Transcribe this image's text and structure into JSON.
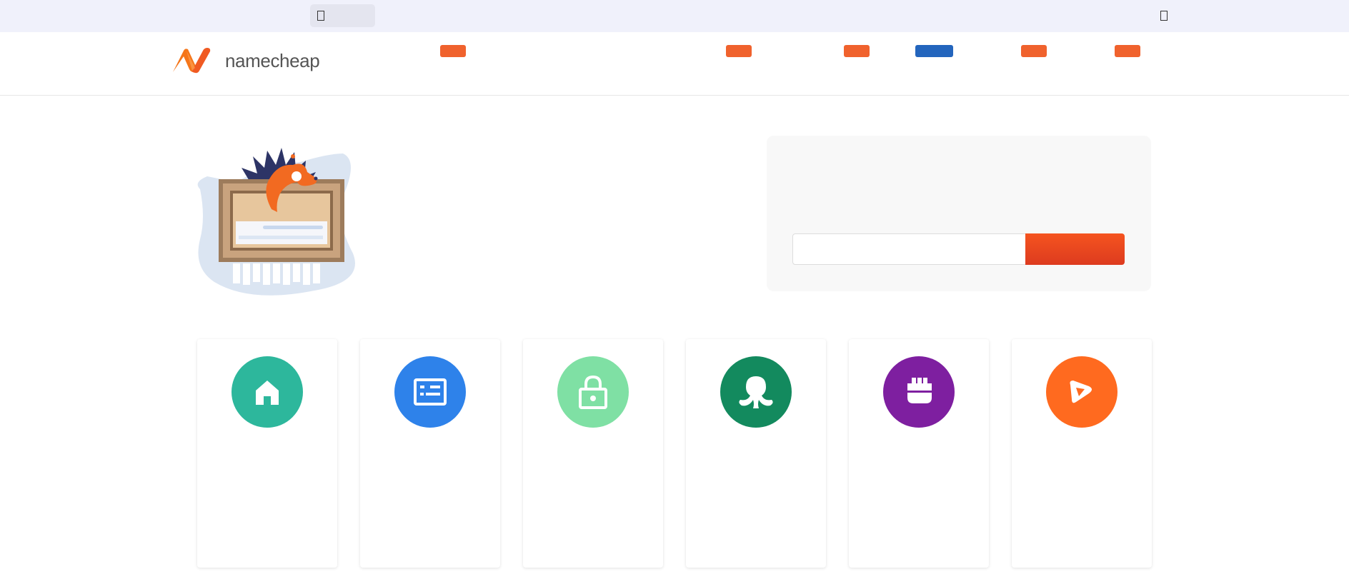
{
  "brand": {
    "name": "namecheap",
    "colors": {
      "orange": "#f0622d",
      "blue": "#2365bd"
    }
  },
  "topbar": {
    "icons": [
      "browser-tab-icon",
      "menu-icon"
    ]
  },
  "nav": {
    "items": [
      {
        "id": "nav-item-1",
        "color": "#f0622d"
      },
      {
        "id": "nav-item-2",
        "color": "#f0622d"
      },
      {
        "id": "nav-item-3",
        "color": "#f0622d"
      },
      {
        "id": "nav-item-4",
        "color": "#2365bd"
      },
      {
        "id": "nav-item-5",
        "color": "#f0622d"
      },
      {
        "id": "nav-item-6",
        "color": "#f0622d"
      }
    ]
  },
  "hero": {
    "illustration": "hedgehog-fox-frame-illustration"
  },
  "search": {
    "value": "",
    "placeholder": "",
    "button_label": ""
  },
  "product_cards": [
    {
      "icon": "house-icon",
      "color": "#2db79c"
    },
    {
      "icon": "server-icon",
      "color": "#2e82ea"
    },
    {
      "icon": "lock-icon",
      "color": "#7fe0a4"
    },
    {
      "icon": "octopus-icon",
      "color": "#138a5e"
    },
    {
      "icon": "plug-icon",
      "color": "#7e1fa0"
    },
    {
      "icon": "play-icon",
      "color": "#ff6a1f"
    }
  ]
}
